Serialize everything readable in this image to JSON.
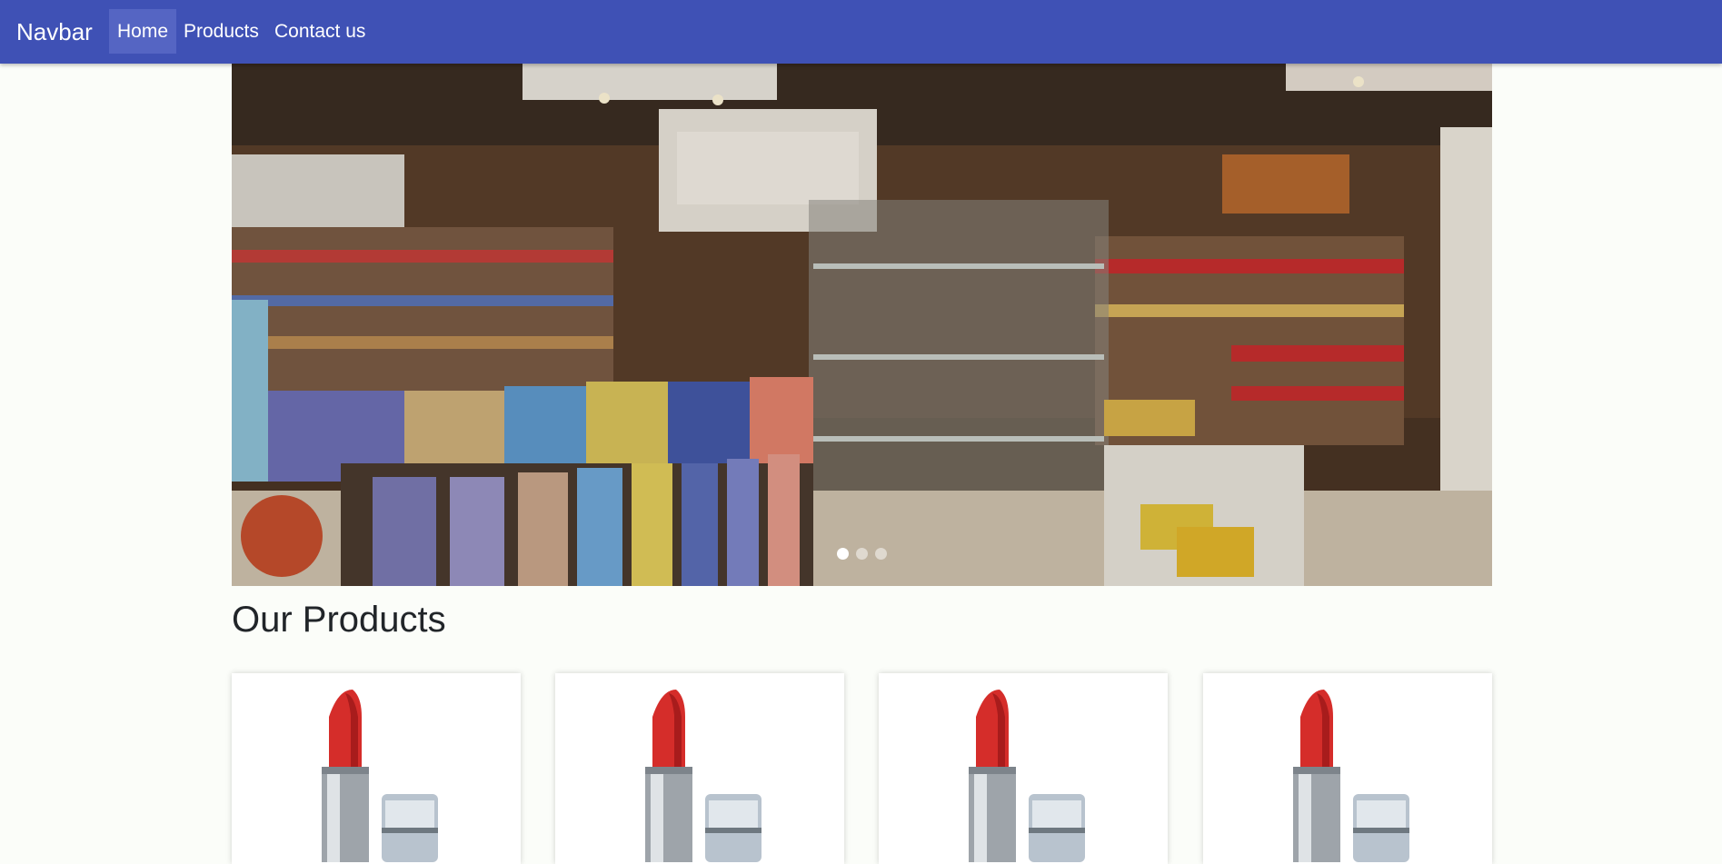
{
  "navbar": {
    "brand": "Navbar",
    "items": [
      {
        "label": "Home",
        "active": true
      },
      {
        "label": "Products",
        "active": false
      },
      {
        "label": "Contact us",
        "active": false
      }
    ],
    "background": "#3f51b5"
  },
  "carousel": {
    "slide_count": 3,
    "active_index": 0,
    "slide_description_icon": "store-interior-image"
  },
  "products": {
    "heading": "Our Products",
    "cards": [
      {
        "image_icon": "lipstick-image"
      },
      {
        "image_icon": "lipstick-image"
      },
      {
        "image_icon": "lipstick-image"
      },
      {
        "image_icon": "lipstick-image"
      }
    ]
  }
}
